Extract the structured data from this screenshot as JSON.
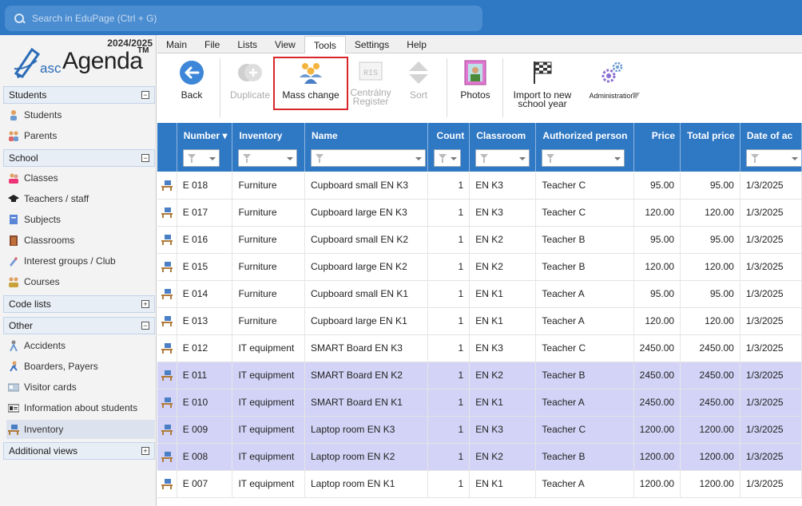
{
  "search": {
    "placeholder": "Search in EduPage (Ctrl + G)"
  },
  "sidebar": {
    "year": "2024/2025",
    "logo_asc": "asc",
    "logo_agenda": "Agenda",
    "logo_tm": "TM",
    "sections": [
      {
        "label": "Students",
        "toggle": "−"
      },
      {
        "label": "School",
        "toggle": "−"
      },
      {
        "label": "Code lists",
        "toggle": "+"
      },
      {
        "label": "Other",
        "toggle": "−"
      },
      {
        "label": "Additional views",
        "toggle": "+"
      }
    ],
    "items": [
      {
        "label": "Students",
        "icon": "student-icon"
      },
      {
        "label": "Parents",
        "icon": "parents-icon"
      },
      {
        "label": "Classes",
        "icon": "classes-icon"
      },
      {
        "label": "Teachers / staff",
        "icon": "graduation-cap-icon"
      },
      {
        "label": "Subjects",
        "icon": "book-icon"
      },
      {
        "label": "Classrooms",
        "icon": "door-icon"
      },
      {
        "label": "Interest groups / Club",
        "icon": "rocket-icon"
      },
      {
        "label": "Courses",
        "icon": "group-icon"
      },
      {
        "label": "Accidents",
        "icon": "accident-icon"
      },
      {
        "label": "Boarders, Payers",
        "icon": "runner-icon"
      },
      {
        "label": "Visitor cards",
        "icon": "card-icon"
      },
      {
        "label": "Information about students",
        "icon": "id-card-icon"
      },
      {
        "label": "Inventory",
        "icon": "desk-icon"
      }
    ]
  },
  "menu": {
    "tabs": [
      "Main",
      "File",
      "Lists",
      "View",
      "Tools",
      "Settings",
      "Help"
    ],
    "active": "Tools"
  },
  "toolbar": {
    "back": "Back",
    "duplicate": "Duplicate",
    "mass_change": "Mass change",
    "central_register_1": "Centrálny",
    "central_register_2": "Register",
    "sort": "Sort",
    "photos": "Photos",
    "import_1": "Import to new",
    "import_2": "school year",
    "administration": "Administration",
    "ris": "RIS"
  },
  "table": {
    "columns": [
      "Number",
      "Inventory",
      "Name",
      "Count",
      "Classroom",
      "Authorized person",
      "Price",
      "Total price",
      "Date of ac"
    ],
    "rows": [
      [
        "E 018",
        "Furniture",
        "Cupboard small EN K3",
        "1",
        "EN K3",
        "Teacher C",
        "95.00",
        "95.00",
        "1/3/2025"
      ],
      [
        "E 017",
        "Furniture",
        "Cupboard large EN K3",
        "1",
        "EN K3",
        "Teacher C",
        "120.00",
        "120.00",
        "1/3/2025"
      ],
      [
        "E 016",
        "Furniture",
        "Cupboard small EN K2",
        "1",
        "EN K2",
        "Teacher B",
        "95.00",
        "95.00",
        "1/3/2025"
      ],
      [
        "E 015",
        "Furniture",
        "Cupboard large EN K2",
        "1",
        "EN K2",
        "Teacher B",
        "120.00",
        "120.00",
        "1/3/2025"
      ],
      [
        "E 014",
        "Furniture",
        "Cupboard small EN K1",
        "1",
        "EN K1",
        "Teacher A",
        "95.00",
        "95.00",
        "1/3/2025"
      ],
      [
        "E 013",
        "Furniture",
        "Cupboard large EN K1",
        "1",
        "EN K1",
        "Teacher A",
        "120.00",
        "120.00",
        "1/3/2025"
      ],
      [
        "E 012",
        "IT equipment",
        "SMART Board EN K3",
        "1",
        "EN K3",
        "Teacher C",
        "2450.00",
        "2450.00",
        "1/3/2025"
      ],
      [
        "E 011",
        "IT equipment",
        "SMART Board EN K2",
        "1",
        "EN K2",
        "Teacher B",
        "2450.00",
        "2450.00",
        "1/3/2025"
      ],
      [
        "E 010",
        "IT equipment",
        "SMART Board EN K1",
        "1",
        "EN K1",
        "Teacher A",
        "2450.00",
        "2450.00",
        "1/3/2025"
      ],
      [
        "E 009",
        "IT equipment",
        "Laptop room EN K3",
        "1",
        "EN K3",
        "Teacher C",
        "1200.00",
        "1200.00",
        "1/3/2025"
      ],
      [
        "E 008",
        "IT equipment",
        "Laptop room EN K2",
        "1",
        "EN K2",
        "Teacher B",
        "1200.00",
        "1200.00",
        "1/3/2025"
      ],
      [
        "E 007",
        "IT equipment",
        "Laptop room EN K1",
        "1",
        "EN K1",
        "Teacher A",
        "1200.00",
        "1200.00",
        "1/3/2025"
      ]
    ],
    "selected_rows": [
      7,
      8,
      9,
      10
    ]
  }
}
